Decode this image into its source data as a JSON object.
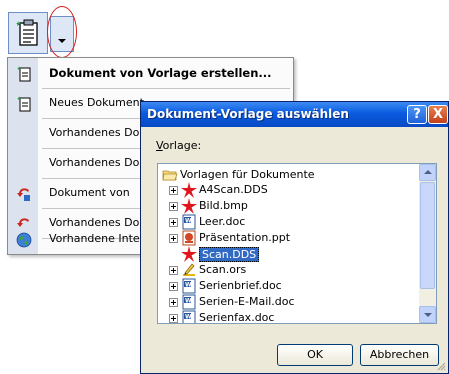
{
  "toolbar": {
    "document_button_icon": "document-clipboard-icon",
    "dropdown_icon": "chevron-down-icon"
  },
  "menu": {
    "items": [
      {
        "label": "Dokument von Vorlage erstellen...",
        "icon": "green-document-icon",
        "bold": true
      },
      {
        "label": "Neues Dokument",
        "icon": "new-document-icon",
        "bold": false
      },
      {
        "label": "Vorhandenes Dokument",
        "icon": "none",
        "bold": false
      },
      {
        "label": "Vorhandenes Dokument",
        "icon": "none",
        "bold": false
      },
      {
        "label": "Dokument von",
        "icon": "red-arrow-icon",
        "bold": false
      },
      {
        "label": "Vorhandenes Dokument",
        "icon": "red-arrow-icon",
        "bold": false
      },
      {
        "label": "Vorhandene Internetseite",
        "icon": "globe-icon",
        "bold": false
      }
    ]
  },
  "dialog": {
    "title": "Dokument-Vorlage auswählen",
    "help_label": "?",
    "close_label": "X",
    "field_label_prefix": "V",
    "field_label_rest": "orlage:",
    "tree": {
      "root": "Vorlagen für Dokumente",
      "items": [
        {
          "label": "A4Scan.DDS",
          "icon": "red-star-icon",
          "expander": true
        },
        {
          "label": "Bild.bmp",
          "icon": "red-star-icon",
          "expander": true
        },
        {
          "label": "Leer.doc",
          "icon": "word-doc-icon",
          "expander": true
        },
        {
          "label": "Präsentation.ppt",
          "icon": "powerpoint-icon",
          "expander": true
        },
        {
          "label": "Scan.DDS",
          "icon": "red-star-icon",
          "expander": false,
          "selected": true
        },
        {
          "label": "Scan.ors",
          "icon": "yellow-pencil-icon",
          "expander": true
        },
        {
          "label": "Serienbrief.doc",
          "icon": "word-doc-icon",
          "expander": true
        },
        {
          "label": "Serien-E-Mail.doc",
          "icon": "word-doc-icon",
          "expander": true
        },
        {
          "label": "Serienfax.doc",
          "icon": "word-doc-icon",
          "expander": true
        }
      ]
    },
    "ok_label": "OK",
    "cancel_label": "Abbrechen"
  },
  "colors": {
    "titlebar": "#0a5be0",
    "selection": "#316ac5",
    "dialog_bg": "#ece9d8",
    "highlight_ring": "#d42020"
  }
}
